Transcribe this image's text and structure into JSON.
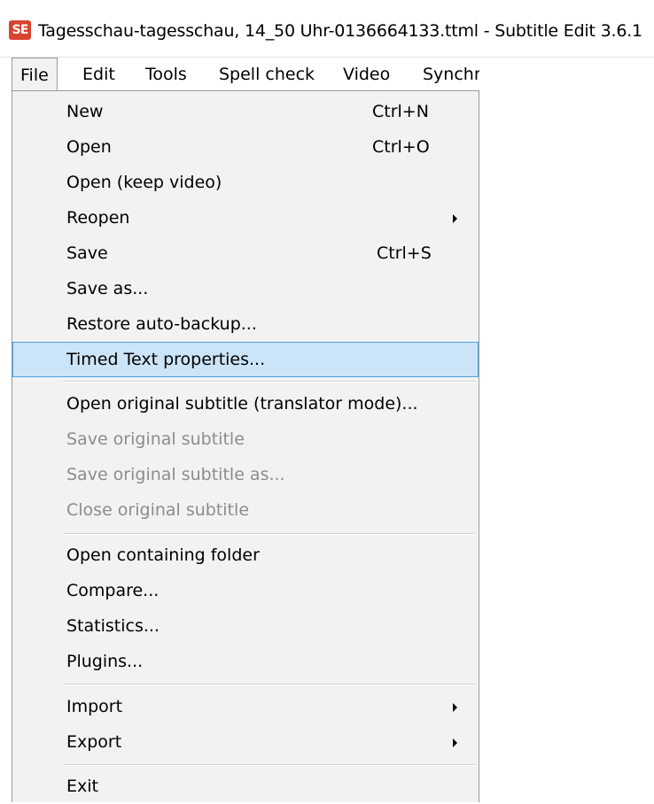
{
  "window": {
    "logo_text": "SE",
    "title": "Tagesschau-tagesschau, 14_50 Uhr-0136664133.ttml - Subtitle Edit 3.6.1"
  },
  "menubar": {
    "items": [
      {
        "label": "File",
        "active": true
      },
      {
        "label": "Edit"
      },
      {
        "label": "Tools"
      },
      {
        "label": "Spell check"
      },
      {
        "label": "Video"
      },
      {
        "label": "Synchr"
      }
    ]
  },
  "file_menu": {
    "items": [
      {
        "label": "New",
        "shortcut": "Ctrl+N"
      },
      {
        "label": "Open",
        "shortcut": "Ctrl+O"
      },
      {
        "label": "Open (keep video)"
      },
      {
        "label": "Reopen",
        "submenu": true
      },
      {
        "label": "Save",
        "shortcut": "Ctrl+S"
      },
      {
        "label": "Save as..."
      },
      {
        "label": "Restore auto-backup..."
      },
      {
        "label": "Timed Text properties...",
        "highlighted": true
      },
      {
        "label": "Open original subtitle (translator mode)..."
      },
      {
        "label": "Save original subtitle",
        "disabled": true
      },
      {
        "label": "Save original subtitle as...",
        "disabled": true
      },
      {
        "label": "Close original subtitle",
        "disabled": true
      },
      {
        "label": "Open containing folder"
      },
      {
        "label": "Compare..."
      },
      {
        "label": "Statistics..."
      },
      {
        "label": "Plugins..."
      },
      {
        "label": "Import",
        "submenu": true
      },
      {
        "label": "Export",
        "submenu": true
      },
      {
        "label": "Exit"
      }
    ]
  },
  "colors": {
    "menu_background": "#f2f2f2",
    "highlight_fill": "#cce4f7",
    "highlight_border": "#4d9fe0",
    "disabled_text": "#8c8c8c",
    "logo_red": "#d9432f"
  }
}
